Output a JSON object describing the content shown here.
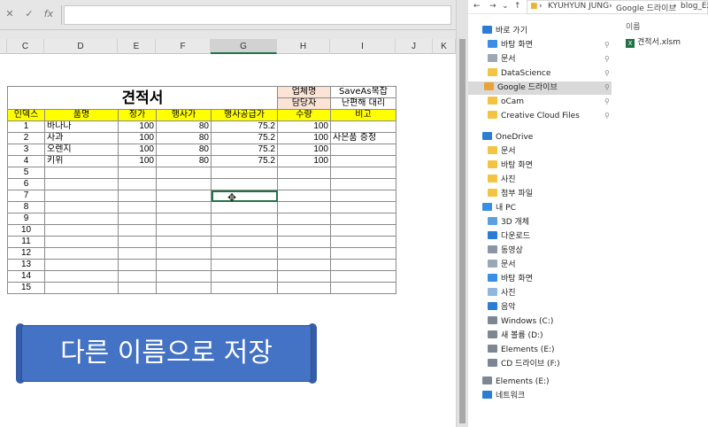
{
  "formula_bar": {
    "cancel": "✕",
    "enter": "✓",
    "fx": "fx",
    "value": ""
  },
  "columns": [
    "C",
    "D",
    "E",
    "F",
    "G",
    "H",
    "I",
    "J",
    "K"
  ],
  "sheet": {
    "title": "견적서",
    "meta": [
      {
        "label": "업체명",
        "value": "SaveAs복잡"
      },
      {
        "label": "담당자",
        "value": "난편해 대리"
      }
    ],
    "headers": [
      "인덱스",
      "품명",
      "정가",
      "행사가",
      "행사공급가",
      "수량",
      "비고"
    ],
    "rows": [
      {
        "index": "1",
        "name": "바나나",
        "price": "100",
        "sale": "80",
        "supply": "75.2",
        "qty": "100",
        "note": ""
      },
      {
        "index": "2",
        "name": "사과",
        "price": "100",
        "sale": "80",
        "supply": "75.2",
        "qty": "100",
        "note": "사은품 증정"
      },
      {
        "index": "3",
        "name": "오렌지",
        "price": "100",
        "sale": "80",
        "supply": "75.2",
        "qty": "100",
        "note": ""
      },
      {
        "index": "4",
        "name": "키위",
        "price": "100",
        "sale": "80",
        "supply": "75.2",
        "qty": "100",
        "note": ""
      },
      {
        "index": "5",
        "name": "",
        "price": "",
        "sale": "",
        "supply": "",
        "qty": "",
        "note": ""
      },
      {
        "index": "6",
        "name": "",
        "price": "",
        "sale": "",
        "supply": "",
        "qty": "",
        "note": ""
      },
      {
        "index": "7",
        "name": "",
        "price": "",
        "sale": "",
        "supply": "",
        "qty": "",
        "note": ""
      },
      {
        "index": "8",
        "name": "",
        "price": "",
        "sale": "",
        "supply": "",
        "qty": "",
        "note": ""
      },
      {
        "index": "9",
        "name": "",
        "price": "",
        "sale": "",
        "supply": "",
        "qty": "",
        "note": ""
      },
      {
        "index": "10",
        "name": "",
        "price": "",
        "sale": "",
        "supply": "",
        "qty": "",
        "note": ""
      },
      {
        "index": "11",
        "name": "",
        "price": "",
        "sale": "",
        "supply": "",
        "qty": "",
        "note": ""
      },
      {
        "index": "12",
        "name": "",
        "price": "",
        "sale": "",
        "supply": "",
        "qty": "",
        "note": ""
      },
      {
        "index": "13",
        "name": "",
        "price": "",
        "sale": "",
        "supply": "",
        "qty": "",
        "note": ""
      },
      {
        "index": "14",
        "name": "",
        "price": "",
        "sale": "",
        "supply": "",
        "qty": "",
        "note": ""
      },
      {
        "index": "15",
        "name": "",
        "price": "",
        "sale": "",
        "supply": "",
        "qty": "",
        "note": ""
      }
    ]
  },
  "banner": {
    "text": "다른 이름으로 저장",
    "color": "#4472c4"
  },
  "explorer": {
    "path": [
      "KYUHYUN JUNG",
      "Google 드라이브",
      "blog_Exc"
    ],
    "column_header": "이름",
    "file": "견적서.xlsm",
    "nav": [
      {
        "label": "바로 가기",
        "icon": "star-icon",
        "color": "#2b7cd3"
      },
      {
        "label": "바탕 화면",
        "icon": "desktop-icon",
        "color": "#3a8ee6"
      },
      {
        "label": "문서",
        "icon": "document-icon",
        "color": "#9aa7b5"
      },
      {
        "label": "DataScience",
        "icon": "folder-icon",
        "color": "#f5c342"
      },
      {
        "label": "Google 드라이브",
        "icon": "google-drive-icon",
        "color": "#e8a33a"
      },
      {
        "label": "oCam",
        "icon": "folder-icon",
        "color": "#f5c342"
      },
      {
        "label": "Creative Cloud Files",
        "icon": "folder-icon",
        "color": "#f5c342"
      },
      {
        "label": "OneDrive",
        "icon": "cloud-icon",
        "color": "#2b7cd3"
      },
      {
        "label": "문서",
        "icon": "folder-icon",
        "color": "#f5c342"
      },
      {
        "label": "바탕 화면",
        "icon": "folder-icon",
        "color": "#f5c342"
      },
      {
        "label": "사진",
        "icon": "folder-icon",
        "color": "#f5c342"
      },
      {
        "label": "첨부 파일",
        "icon": "folder-icon",
        "color": "#f5c342"
      },
      {
        "label": "내 PC",
        "icon": "pc-icon",
        "color": "#3a8ee6"
      },
      {
        "label": "3D 개체",
        "icon": "3d-objects-icon",
        "color": "#5aa0e0"
      },
      {
        "label": "다운로드",
        "icon": "download-icon",
        "color": "#2b7cd3"
      },
      {
        "label": "동영상",
        "icon": "video-icon",
        "color": "#8a96a6"
      },
      {
        "label": "문서",
        "icon": "document-icon",
        "color": "#9aa7b5"
      },
      {
        "label": "바탕 화면",
        "icon": "desktop-icon",
        "color": "#3a8ee6"
      },
      {
        "label": "사진",
        "icon": "picture-icon",
        "color": "#8fb6dc"
      },
      {
        "label": "음악",
        "icon": "music-icon",
        "color": "#2b7cd3"
      },
      {
        "label": "Windows (C:)",
        "icon": "drive-icon",
        "color": "#7d8794"
      },
      {
        "label": "새 볼륨 (D:)",
        "icon": "drive-icon",
        "color": "#7d8794"
      },
      {
        "label": "Elements (E:)",
        "icon": "drive-icon",
        "color": "#7d8794"
      },
      {
        "label": "CD 드라이브 (F:)",
        "icon": "cd-drive-icon",
        "color": "#7d8794"
      },
      {
        "label": "Elements (E:)",
        "icon": "drive-icon",
        "color": "#7d8794"
      },
      {
        "label": "네트워크",
        "icon": "network-icon",
        "color": "#2b7cd3"
      }
    ]
  }
}
